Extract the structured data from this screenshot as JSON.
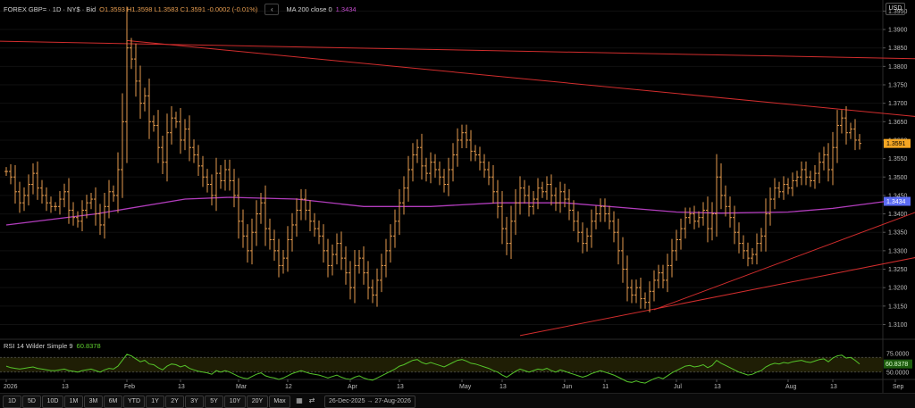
{
  "legend": {
    "symbol": "FOREX GBP= · 1D · NY$ · Bid",
    "ohlc": "O1.3593 H1.3598 L1.3583 C1.3591 -0.0002 (-0.01%)",
    "collapse": "‹",
    "ma_label": "MA 200 close 0",
    "ma_value": "1.3434",
    "rsi_label": "RSI 14 Wilder Simple 9",
    "rsi_value": "60.8378"
  },
  "currency_button": "USD",
  "toolbar": {
    "periods": [
      "1D",
      "5D",
      "10D",
      "1M",
      "3M",
      "6M",
      "YTD",
      "1Y",
      "2Y",
      "3Y",
      "5Y",
      "10Y",
      "20Y",
      "Max"
    ],
    "date_range": "26-Dec-2025 → 27-Aug-2026",
    "icons": [
      "calendar-icon",
      "adjust-icon"
    ]
  },
  "colors": {
    "bars": "#e39a4e",
    "ma": "#b23dbd",
    "trend": "#d12d2d",
    "rsi": "#55c42a",
    "price_label": "#f5a623",
    "ma_label": "#5c6cf5"
  },
  "chart_data": {
    "type": "ohlc",
    "price_axis": {
      "ylim": [
        1.306,
        1.398
      ],
      "ticks": [
        "1.3950",
        "1.3900",
        "1.3850",
        "1.3800",
        "1.3750",
        "1.3700",
        "1.3650",
        "1.3600",
        "1.3550",
        "1.3500",
        "1.3450",
        "1.3400",
        "1.3350",
        "1.3300",
        "1.3250",
        "1.3200",
        "1.3150",
        "1.3100"
      ]
    },
    "x_axis": {
      "labels": [
        {
          "t": 0,
          "label": "2026"
        },
        {
          "t": 13,
          "label": "13"
        },
        {
          "t": 27,
          "label": "Feb"
        },
        {
          "t": 39,
          "label": "13"
        },
        {
          "t": 52,
          "label": "Mar"
        },
        {
          "t": 63,
          "label": "12"
        },
        {
          "t": 77,
          "label": "Apr"
        },
        {
          "t": 88,
          "label": "13"
        },
        {
          "t": 102,
          "label": "May"
        },
        {
          "t": 111,
          "label": "13"
        },
        {
          "t": 125,
          "label": "Jun"
        },
        {
          "t": 134,
          "label": "11"
        },
        {
          "t": 150,
          "label": "Jul"
        },
        {
          "t": 159,
          "label": "13"
        },
        {
          "t": 175,
          "label": "Aug"
        },
        {
          "t": 185,
          "label": "13"
        },
        {
          "t": 199,
          "label": "Sep"
        }
      ]
    },
    "close_series": [
      1.3515,
      1.35,
      1.346,
      1.343,
      1.345,
      1.348,
      1.351,
      1.347,
      1.345,
      1.343,
      1.342,
      1.342,
      1.344,
      1.346,
      1.341,
      1.339,
      1.338,
      1.341,
      1.343,
      1.344,
      1.34,
      1.337,
      1.342,
      1.346,
      1.345,
      1.352,
      1.365,
      1.385,
      1.382,
      1.376,
      1.37,
      1.372,
      1.365,
      1.364,
      1.358,
      1.354,
      1.362,
      1.366,
      1.365,
      1.36,
      1.363,
      1.358,
      1.356,
      1.353,
      1.35,
      1.348,
      1.345,
      1.351,
      1.349,
      1.352,
      1.349,
      1.345,
      1.338,
      1.334,
      1.33,
      1.335,
      1.34,
      1.343,
      1.336,
      1.333,
      1.33,
      1.326,
      1.328,
      1.333,
      1.337,
      1.341,
      1.344,
      1.341,
      1.338,
      1.336,
      1.334,
      1.33,
      1.326,
      1.329,
      1.332,
      1.328,
      1.324,
      1.32,
      1.326,
      1.328,
      1.324,
      1.32,
      1.318,
      1.322,
      1.326,
      1.33,
      1.334,
      1.338,
      1.343,
      1.347,
      1.352,
      1.356,
      1.358,
      1.353,
      1.351,
      1.354,
      1.352,
      1.35,
      1.348,
      1.352,
      1.356,
      1.36,
      1.362,
      1.36,
      1.357,
      1.356,
      1.354,
      1.352,
      1.35,
      1.346,
      1.342,
      1.336,
      1.332,
      1.338,
      1.343,
      1.347,
      1.345,
      1.342,
      1.344,
      1.347,
      1.346,
      1.348,
      1.345,
      1.343,
      1.346,
      1.344,
      1.341,
      1.338,
      1.335,
      1.332,
      1.334,
      1.338,
      1.34,
      1.342,
      1.34,
      1.338,
      1.335,
      1.33,
      1.325,
      1.32,
      1.318,
      1.32,
      1.317,
      1.316,
      1.319,
      1.322,
      1.324,
      1.322,
      1.326,
      1.33,
      1.333,
      1.336,
      1.339,
      1.34,
      1.338,
      1.339,
      1.341,
      1.336,
      1.34,
      1.35,
      1.345,
      1.342,
      1.339,
      1.335,
      1.332,
      1.33,
      1.328,
      1.329,
      1.332,
      1.334,
      1.34,
      1.344,
      1.347,
      1.346,
      1.348,
      1.347,
      1.349,
      1.35,
      1.352,
      1.35,
      1.349,
      1.351,
      1.354,
      1.356,
      1.352,
      1.358,
      1.364,
      1.366,
      1.362,
      1.363,
      1.36,
      1.3591
    ],
    "ma200": {
      "name": "MA 200 close 0",
      "points": [
        [
          0,
          1.337
        ],
        [
          20,
          1.34
        ],
        [
          40,
          1.344
        ],
        [
          50,
          1.3445
        ],
        [
          65,
          1.344
        ],
        [
          80,
          1.342
        ],
        [
          95,
          1.342
        ],
        [
          110,
          1.343
        ],
        [
          125,
          1.343
        ],
        [
          140,
          1.3415
        ],
        [
          150,
          1.3405
        ],
        [
          160,
          1.3402
        ],
        [
          175,
          1.3405
        ],
        [
          185,
          1.3415
        ],
        [
          197,
          1.3434
        ]
      ]
    },
    "trend_lines": [
      {
        "points": [
          [
            -9,
            1.387
          ],
          [
            207,
            1.382
          ]
        ]
      },
      {
        "points": [
          [
            27,
            1.387
          ],
          [
            207,
            1.366
          ]
        ]
      },
      {
        "points": [
          [
            145,
            1.314
          ],
          [
            207,
            1.342
          ]
        ]
      },
      {
        "points": [
          [
            115,
            1.307
          ],
          [
            207,
            1.329
          ]
        ]
      }
    ],
    "last_price": "1.3591",
    "last_ma": "1.3434",
    "rsi": {
      "name": "RSI 14 Wilder Simple 9",
      "ylim": [
        40,
        80
      ],
      "ticks": [
        "75.0000",
        "50.0000"
      ],
      "bands": [
        70,
        50
      ],
      "last": "60.8378",
      "values": [
        58,
        56,
        55,
        54,
        55,
        56,
        57,
        55,
        54,
        53,
        52,
        52,
        53,
        54,
        52,
        51,
        50,
        52,
        53,
        54,
        52,
        50,
        53,
        55,
        54,
        58,
        66,
        74,
        72,
        68,
        64,
        66,
        61,
        60,
        56,
        53,
        58,
        61,
        60,
        57,
        59,
        55,
        53,
        51,
        50,
        49,
        47,
        52,
        50,
        52,
        50,
        47,
        44,
        42,
        41,
        44,
        47,
        49,
        45,
        43,
        42,
        40,
        42,
        45,
        48,
        50,
        52,
        50,
        48,
        47,
        46,
        44,
        42,
        44,
        46,
        43,
        41,
        40,
        43,
        45,
        42,
        40,
        39,
        42,
        45,
        48,
        51,
        54,
        58,
        60,
        63,
        66,
        67,
        63,
        61,
        63,
        61,
        59,
        57,
        60,
        63,
        66,
        67,
        65,
        62,
        61,
        59,
        57,
        55,
        52,
        50,
        46,
        43,
        47,
        51,
        54,
        52,
        50,
        52,
        54,
        53,
        55,
        52,
        50,
        53,
        51,
        49,
        47,
        45,
        43,
        45,
        48,
        50,
        52,
        50,
        48,
        46,
        43,
        40,
        37,
        36,
        38,
        36,
        35,
        38,
        41,
        43,
        41,
        45,
        49,
        52,
        55,
        58,
        59,
        57,
        58,
        60,
        56,
        59,
        66,
        62,
        59,
        56,
        53,
        50,
        48,
        46,
        47,
        50,
        52,
        57,
        60,
        62,
        61,
        63,
        62,
        64,
        65,
        66,
        64,
        63,
        65,
        67,
        68,
        64,
        69,
        72,
        73,
        69,
        70,
        66,
        61
      ]
    }
  }
}
